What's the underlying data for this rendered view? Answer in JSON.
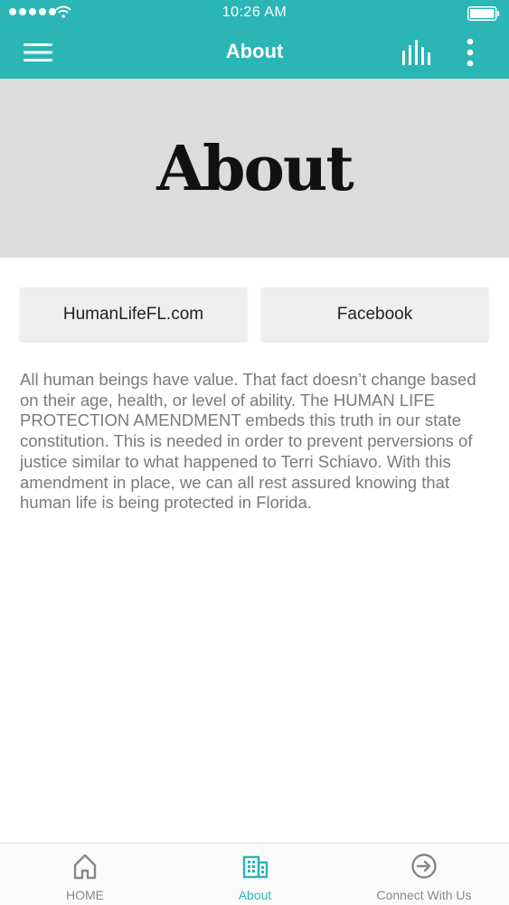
{
  "status_bar": {
    "time": "10:26 AM",
    "icons": [
      "signal-dots-icon",
      "wifi-icon",
      "battery-icon"
    ]
  },
  "nav": {
    "title": "About",
    "left_icon": "hamburger-menu-icon",
    "right_icons": [
      "bar-chart-icon",
      "more-vertical-icon"
    ]
  },
  "banner": {
    "title": "About"
  },
  "buttons": {
    "website_label": "HumanLifeFL.com",
    "facebook_label": "Facebook"
  },
  "content": {
    "body": "All human beings have value. That fact doesn’t change based on their age, health, or level of ability. The HUMAN LIFE PROTECTION AMENDMENT embeds this truth in our state constitution. This is needed in order to prevent perversions of justice similar to what happened to Terri Schiavo. With this amendment in place, we can all rest assured knowing that human life is being protected in Florida."
  },
  "tabs": [
    {
      "label": "HOME",
      "icon": "home-icon",
      "active": false
    },
    {
      "label": "About",
      "icon": "building-icon",
      "active": true
    },
    {
      "label": "Connect With Us",
      "icon": "arrow-circle-right-icon",
      "active": false
    }
  ],
  "colors": {
    "accent": "#2bb5b5",
    "banner_bg": "#dcdcdc",
    "button_bg": "#efeff1",
    "body_text": "#7a7a7a",
    "inactive_tab": "#888888"
  }
}
